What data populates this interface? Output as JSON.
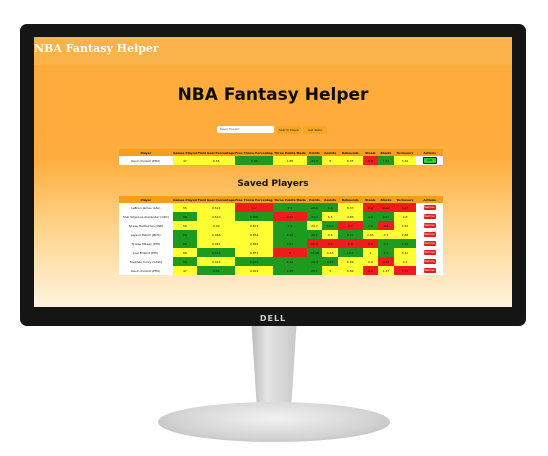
{
  "brand": {
    "title": "NBA Fantasy Helper"
  },
  "main": {
    "title": "NBA Fantasy Helper",
    "search_value": "Kevin Durant",
    "search_button": "Search Player",
    "stats_button": "Get Stats"
  },
  "columns": [
    "Player",
    "Games Played",
    "Field Goal Percentage",
    "Free Throw Percentage",
    "Three Points Made",
    "Points",
    "Assists",
    "Rebounds",
    "Steals",
    "Blocks",
    "Turnovers",
    "Actions"
  ],
  "search_results": [
    {
      "player": "Kevin Durant (PHX)",
      "gp": "47",
      "fg": "0.55",
      "ft": "0.88",
      "tpm": "1.85",
      "pts": "29.7",
      "ast": "5",
      "reb": "6.35",
      "stl": "0.4",
      "blk": "1.53",
      "tov": "3.32",
      "action": "Add"
    }
  ],
  "saved_title": "Saved Players",
  "saved_players": [
    {
      "player": "LeBron James (LAL)",
      "gp": "55",
      "fg": "0.514",
      "ft": "0.7",
      "tpm": "2.2",
      "pts": "28.9",
      "ast": "6.8",
      "reb": "8.33",
      "stl": "0.9",
      "blk": "0.64",
      "tov": "3.27",
      "action": "Remove"
    },
    {
      "player": "Shai Gilgeous-Alexander (OKC)",
      "gp": "68",
      "fg": "0.510",
      "ft": "0.905",
      "tpm": "0.91",
      "pts": "31.4",
      "ast": "5.5",
      "reb": "4.83",
      "stl": "1.6",
      "blk": "0.97",
      "tov": "2.8",
      "action": "Remove"
    },
    {
      "player": "Tyrese Haliburton (IND)",
      "gp": "56",
      "fg": "0.49",
      "ft": "0.871",
      "tpm": "2.9",
      "pts": "20.7",
      "ast": "10.4",
      "reb": "3.7",
      "stl": "1.6",
      "blk": "0.4",
      "tov": "2.52",
      "action": "Remove"
    },
    {
      "player": "Jayson Tatum (BOS)",
      "gp": "74",
      "fg": "0.466",
      "ft": "0.854",
      "tpm": "3.16",
      "pts": "30.1",
      "ast": "4.6",
      "reb": "8.77",
      "stl": "1.05",
      "blk": "0.7",
      "tov": "2.88",
      "action": "Remove"
    },
    {
      "player": "Tyrese Maxey (PHI)",
      "gp": "60",
      "fg": "0.481",
      "ft": "0.845",
      "tpm": "2.67",
      "pts": "20.3",
      "ast": "3.5",
      "reb": "2.9",
      "stl": "0.8",
      "blk": "0.1",
      "tov": "1.59",
      "action": "Remove"
    },
    {
      "player": "Joel Embiid (PHI)",
      "gp": "66",
      "fg": "0.548",
      "ft": "0.857",
      "tpm": "1",
      "pts": "33.08",
      "ast": "4.15",
      "reb": "10.2",
      "stl": "1",
      "blk": "1.7",
      "tov": "3.41",
      "action": "Remove"
    },
    {
      "player": "Stephen Curry (GSW)",
      "gp": "56",
      "fg": "0.493",
      "ft": "0.915",
      "tpm": "4.92",
      "pts": "29.4",
      "ast": "6.29",
      "reb": "6.09",
      "stl": "0.9",
      "blk": "0.34",
      "tov": "3.2",
      "action": "Remove"
    },
    {
      "player": "Kevin Durant (PHX)",
      "gp": "47",
      "fg": "0.56",
      "ft": "0.919",
      "tpm": "1.85",
      "pts": "29.1",
      "ast": "5",
      "reb": "6.69",
      "stl": "0.5",
      "blk": "1.37",
      "tov": "3.32",
      "action": "Remove"
    }
  ],
  "colors": {
    "good": "#1e9a1e",
    "medium": "#ffff33",
    "poor": "#ee1c1c",
    "header": "#f59d1c",
    "add_button": "#2bd32b",
    "remove_button": "#e02020"
  },
  "cell_ratings": {
    "search": [
      [
        "y",
        "y",
        "g",
        "y",
        "g",
        "y",
        "y",
        "r",
        "g",
        "y"
      ]
    ],
    "saved": [
      [
        "y",
        "y",
        "r",
        "g",
        "g",
        "g",
        "y",
        "r",
        "r",
        "r"
      ],
      [
        "g",
        "y",
        "g",
        "r",
        "g",
        "y",
        "y",
        "g",
        "g",
        "y"
      ],
      [
        "y",
        "y",
        "y",
        "g",
        "y",
        "g",
        "r",
        "g",
        "r",
        "y"
      ],
      [
        "g",
        "y",
        "y",
        "g",
        "g",
        "y",
        "g",
        "y",
        "y",
        "y"
      ],
      [
        "g",
        "y",
        "y",
        "g",
        "r",
        "r",
        "r",
        "r",
        "g",
        "g"
      ],
      [
        "y",
        "g",
        "y",
        "r",
        "g",
        "y",
        "g",
        "y",
        "g",
        "y"
      ],
      [
        "g",
        "y",
        "g",
        "g",
        "g",
        "g",
        "y",
        "y",
        "r",
        "y"
      ],
      [
        "y",
        "g",
        "y",
        "g",
        "g",
        "y",
        "y",
        "r",
        "y",
        "r"
      ]
    ]
  },
  "monitor": {
    "logo": "DELL"
  }
}
